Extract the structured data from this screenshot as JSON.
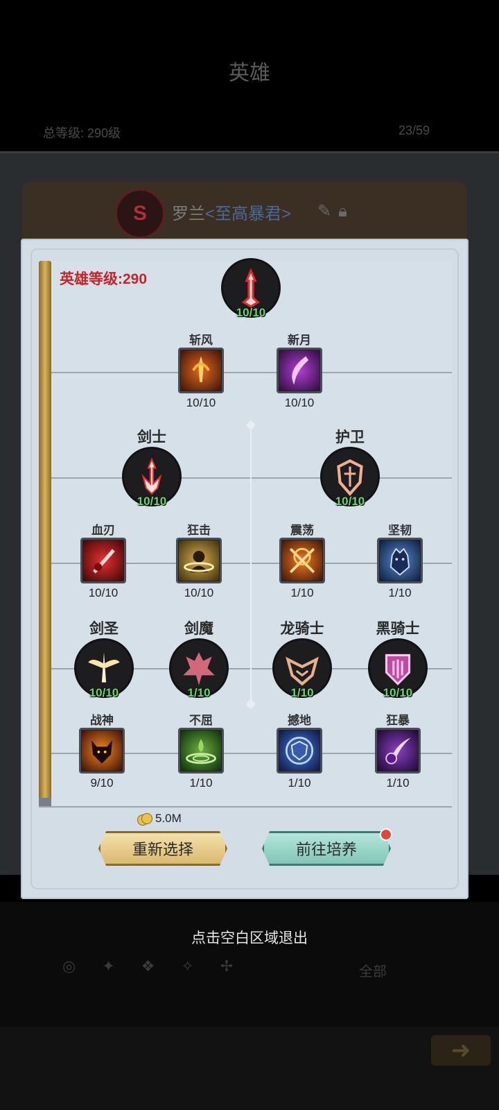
{
  "background": {
    "title": "英雄",
    "left_stat": "总等级: 290级",
    "right_stat": "23/59",
    "hero_name": "罗兰",
    "hero_title": "<至高暴君>",
    "filter_label": "全部"
  },
  "panel": {
    "hero_level_label": "英雄等级:",
    "hero_level_value": "290",
    "root": {
      "level": "10/10",
      "icon": "sword-emblem-icon"
    },
    "tier1": [
      {
        "label": "斩风",
        "level": "10/10",
        "icon": "flame-sword-icon"
      },
      {
        "label": "新月",
        "level": "10/10",
        "icon": "crescent-blade-icon"
      }
    ],
    "classes": [
      {
        "label": "剑士",
        "level": "10/10",
        "icon": "swordsman-icon"
      },
      {
        "label": "护卫",
        "level": "10/10",
        "icon": "guardian-icon"
      }
    ],
    "tier2": [
      {
        "label": "血刃",
        "level": "10/10",
        "icon": "blood-blade-icon"
      },
      {
        "label": "狂击",
        "level": "10/10",
        "icon": "frenzy-strike-icon"
      },
      {
        "label": "震荡",
        "level": "1/10",
        "icon": "shockwave-icon"
      },
      {
        "label": "坚韧",
        "level": "1/10",
        "icon": "tenacity-icon"
      }
    ],
    "advanced": [
      {
        "label": "剑圣",
        "level": "10/10",
        "icon": "sword-saint-icon"
      },
      {
        "label": "剑魔",
        "level": "1/10",
        "icon": "sword-demon-icon"
      },
      {
        "label": "龙骑士",
        "level": "1/10",
        "icon": "dragon-knight-icon"
      },
      {
        "label": "黑骑士",
        "level": "10/10",
        "icon": "black-knight-icon"
      }
    ],
    "tier3": [
      {
        "label": "战神",
        "level": "9/10",
        "icon": "war-god-icon"
      },
      {
        "label": "不屈",
        "level": "1/10",
        "icon": "unyielding-icon"
      },
      {
        "label": "撼地",
        "level": "1/10",
        "icon": "earth-shaker-icon"
      },
      {
        "label": "狂暴",
        "level": "1/10",
        "icon": "berserk-icon"
      }
    ],
    "cost": "5.0M",
    "reselect_button": "重新选择",
    "train_button": "前往培养"
  },
  "exit_hint": "点击空白区域退出",
  "colors": {
    "level_green": "#66d96a",
    "hero_level_red": "#c0262a",
    "panel_bg": "#d3dde6"
  }
}
